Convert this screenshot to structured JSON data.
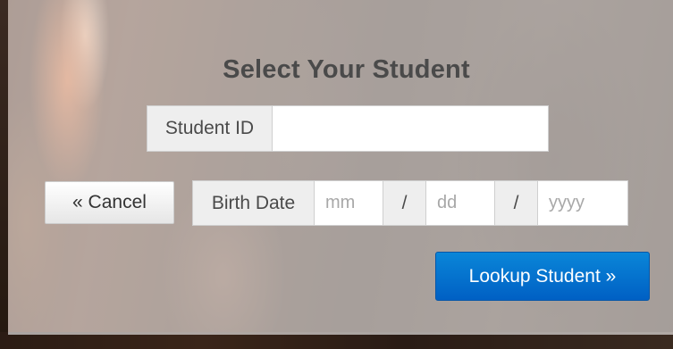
{
  "form": {
    "title": "Select Your Student",
    "student_id": {
      "label": "Student ID",
      "value": "",
      "placeholder": ""
    },
    "birth_date": {
      "label": "Birth Date",
      "month_placeholder": "mm",
      "separator_1": "/",
      "day_placeholder": "dd",
      "separator_2": "/",
      "year_placeholder": "yyyy"
    },
    "cancel_label": "« Cancel",
    "lookup_label": "Lookup Student »"
  },
  "colors": {
    "primary_button": "#0a74d0",
    "title_text": "#4a4a4a"
  }
}
